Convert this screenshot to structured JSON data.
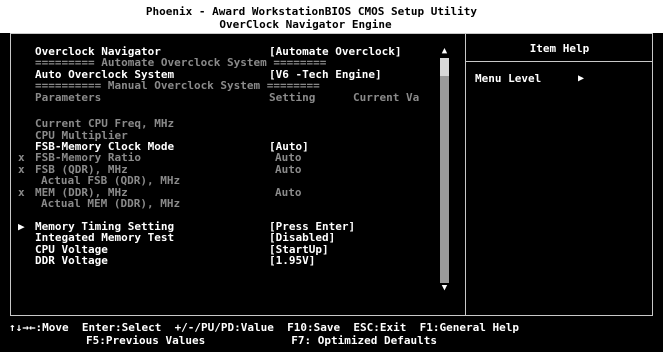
{
  "header": {
    "title": "Phoenix - Award WorkstationBIOS CMOS Setup Utility",
    "subtitle": "OverClock Navigator Engine"
  },
  "menu": {
    "overclock_navigator": {
      "label": "Overclock Navigator",
      "value": "[Automate Overclock]"
    },
    "auto_section_sep": "========= Automate Overclock System ========",
    "auto_overclock_system": {
      "label": "Auto Overclock System",
      "value": "[V6 -Tech Engine]"
    },
    "manual_section_sep": "========== Manual Overclock System ========",
    "params_header": {
      "label": "Parameters",
      "setting": "Setting",
      "current": "Current Va"
    },
    "current_cpu_freq": "Current CPU Freq, MHz",
    "cpu_multiplier": "CPU Multiplier",
    "fsb_memory_clock_mode": {
      "label": "FSB-Memory Clock Mode",
      "value": "[Auto]"
    },
    "fsb_memory_ratio": {
      "marker": "x",
      "label": "FSB-Memory Ratio",
      "value": "Auto"
    },
    "fsb_qdr": {
      "marker": "x",
      "label": "FSB (QDR), MHz",
      "value": "Auto"
    },
    "actual_fsb_qdr": "Actual FSB (QDR), MHz",
    "mem_ddr": {
      "marker": "x",
      "label": "MEM (DDR), MHz",
      "value": "Auto"
    },
    "actual_mem_ddr": "Actual MEM (DDR), MHz",
    "memory_timing": {
      "marker": "▶",
      "label": "Memory Timing Setting",
      "value": "[Press Enter]"
    },
    "memory_test": {
      "label": "Integated Memory Test",
      "value": "[Disabled]"
    },
    "cpu_voltage": {
      "label": "CPU Voltage",
      "value": "[StartUp]"
    },
    "ddr_voltage": {
      "label": "DDR Voltage",
      "value": "[1.95V]"
    }
  },
  "scrollbar": {
    "up_arrow": "▲",
    "down_arrow": "▼"
  },
  "help_panel": {
    "title": "Item Help",
    "menu_level": "Menu Level",
    "menu_level_arrow": "▶"
  },
  "footer": {
    "line1": "↑↓→←:Move  Enter:Select  +/-/PU/PD:Value  F10:Save  ESC:Exit  F1:General Help",
    "line2": "F5:Previous Values             F7: Optimized Defaults"
  },
  "colors": {
    "background": "#000000",
    "text": "#ffffff",
    "disabled_text": "#8a8a8a",
    "border": "#c8c8c8"
  }
}
